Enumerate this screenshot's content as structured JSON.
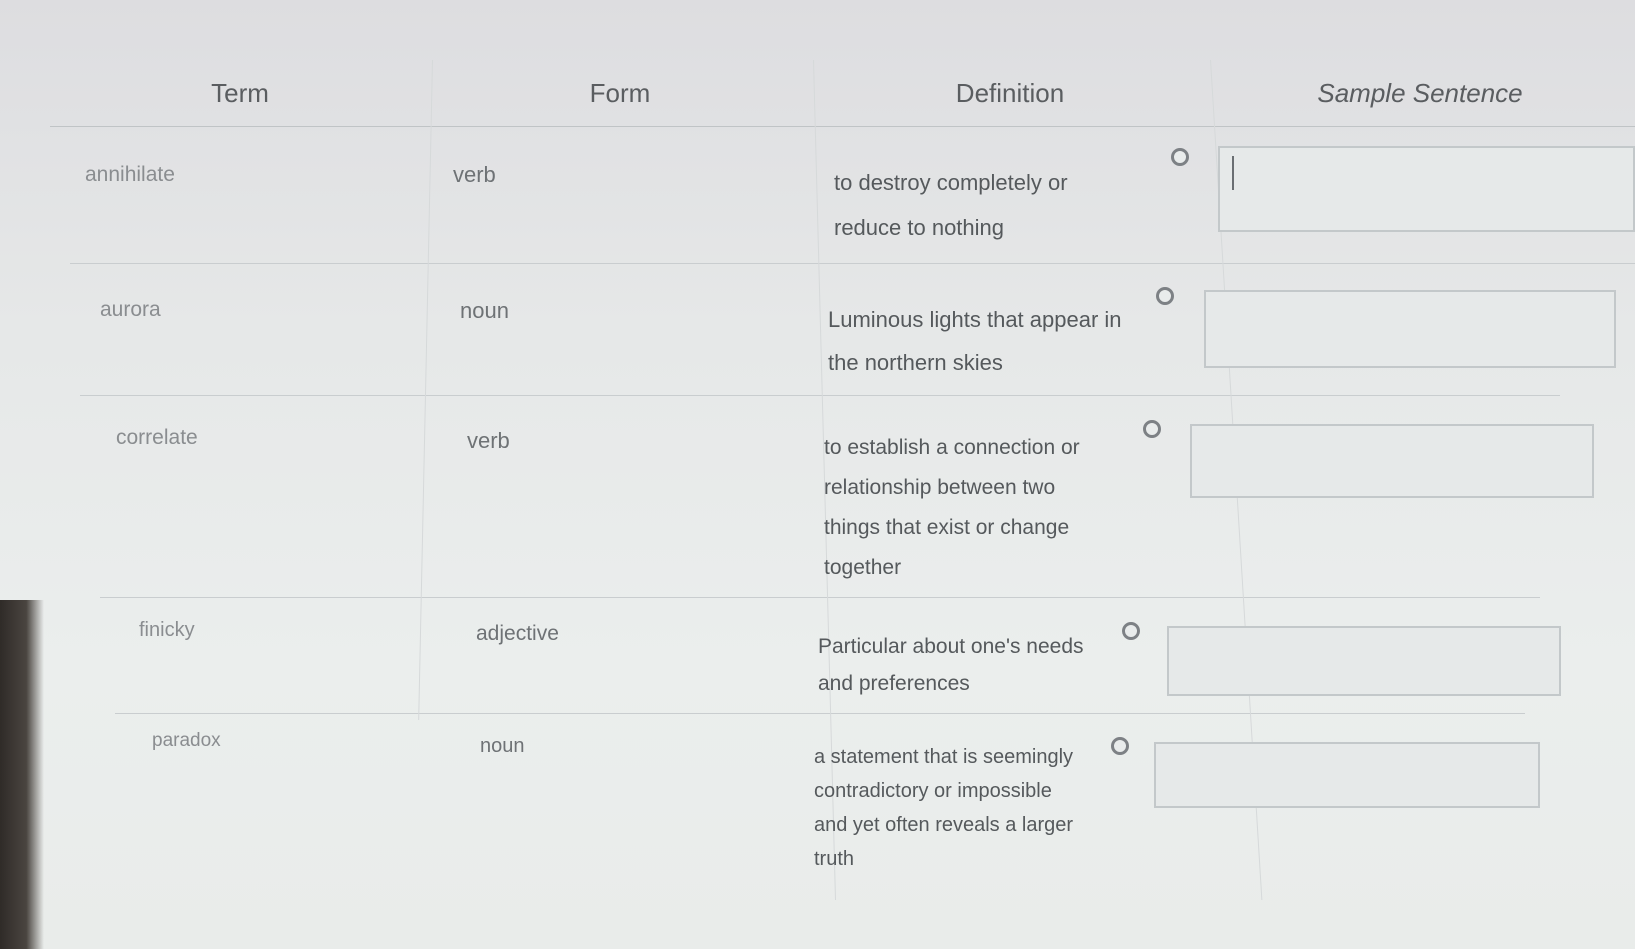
{
  "table": {
    "headers": {
      "term": "Term",
      "form": "Form",
      "definition": "Definition",
      "sentence": "Sample Sentence"
    },
    "rows": [
      {
        "term": "annihilate",
        "form": "verb",
        "definition_lines": [
          "to destroy completely or",
          "reduce to nothing"
        ],
        "sentence_value": "",
        "focused": true
      },
      {
        "term": "aurora",
        "form": "noun",
        "definition_lines": [
          "Luminous lights that appear in",
          "the northern skies"
        ],
        "sentence_value": "",
        "focused": false
      },
      {
        "term": "correlate",
        "form": "verb",
        "definition_lines": [
          "to establish a connection or",
          "relationship between two",
          "things that exist or change",
          "together"
        ],
        "sentence_value": "",
        "focused": false
      },
      {
        "term": "finicky",
        "form": "adjective",
        "definition_lines": [
          "Particular about one's needs",
          "and preferences"
        ],
        "sentence_value": "",
        "focused": false
      },
      {
        "term": "paradox",
        "form": "noun",
        "definition_lines": [
          "a statement that is seemingly",
          "contradictory or impossible",
          "and yet often reveals a larger",
          "truth"
        ],
        "sentence_value": "",
        "focused": false
      }
    ]
  },
  "icons": {
    "definition_marker": "radio-circle-icon"
  },
  "colors": {
    "text_header": "#5a5d60",
    "text_term": "#8a8d90",
    "text_definition": "#55595c",
    "input_border": "#c3c8ca"
  }
}
